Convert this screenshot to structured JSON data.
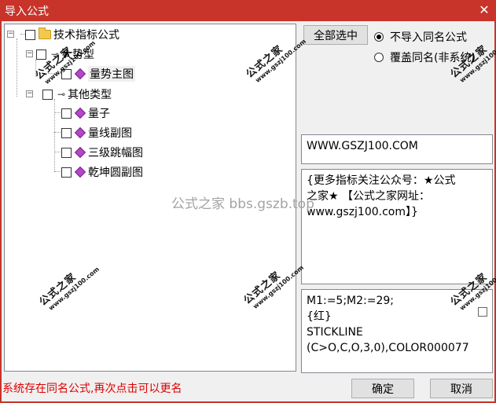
{
  "window": {
    "title": "导入公式",
    "close_glyph": "✕"
  },
  "tree": {
    "root": {
      "label": "技术指标公式"
    },
    "groups": [
      {
        "label": "大势型",
        "items": [
          {
            "label": "量势主图"
          }
        ]
      },
      {
        "label": "其他类型",
        "items": [
          {
            "label": "量子"
          },
          {
            "label": "量线副图"
          },
          {
            "label": "三级跳幅图"
          },
          {
            "label": "乾坤圆副图"
          }
        ]
      }
    ]
  },
  "controls": {
    "select_all": "全部选中",
    "option_skip": "不导入同名公式",
    "option_overwrite": "覆盖同名(非系统)"
  },
  "site_box": {
    "text": "WWW.GSZJ100.COM"
  },
  "desc_box": {
    "lines": [
      "{更多指标关注公众号：★公式",
      "之家★ 【公式之家网址：",
      "www.gszj100.com】}"
    ]
  },
  "code_box": {
    "lines": [
      "M1:=5;M2:=29;",
      "{红}",
      "STICKLINE",
      "(C>O,C,O,3,0),COLOR000077"
    ]
  },
  "status": "系统存在同名公式,再次点击可以更名",
  "buttons": {
    "ok": "确定",
    "cancel": "取消"
  },
  "watermark": {
    "brand": "公式之家",
    "url": "www.gszj100.com",
    "center": "公式之家 bbs.gszb.top"
  },
  "colors": {
    "title_bg": "#c8342a",
    "status": "#e00000"
  },
  "icons": {
    "folder": "folder-icon",
    "formula": "formula-gem-icon",
    "group": "group-key-icon"
  }
}
